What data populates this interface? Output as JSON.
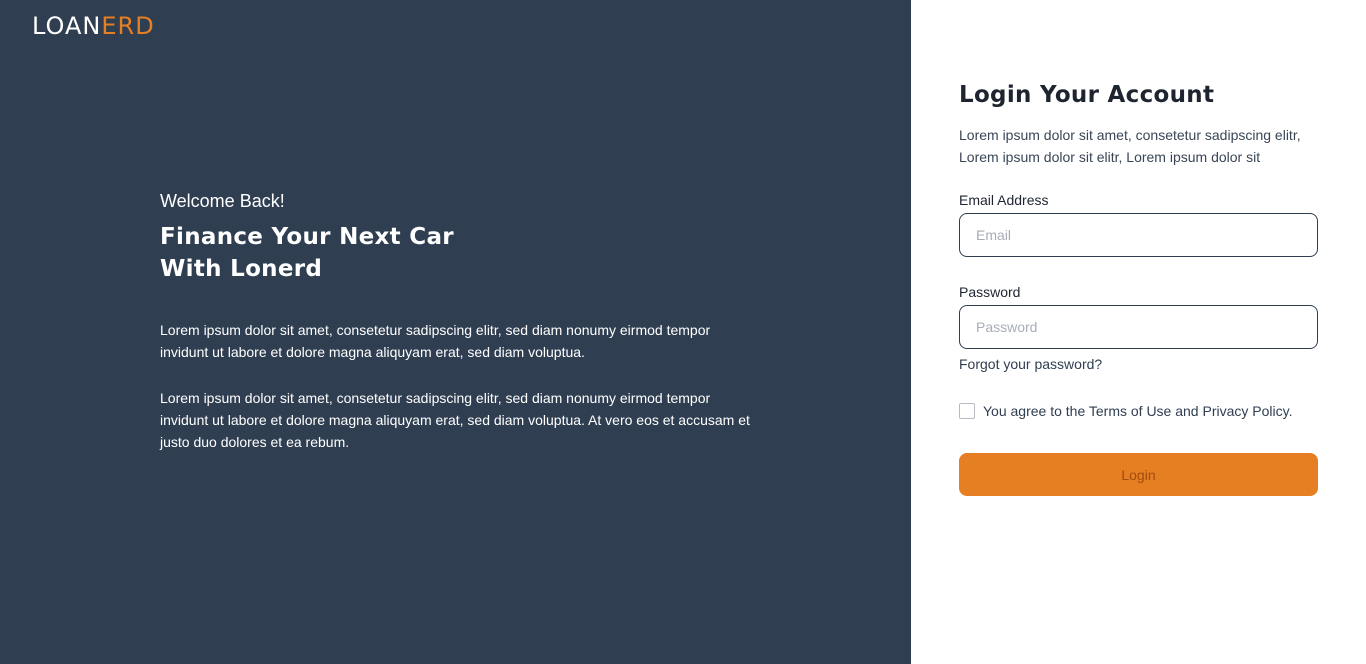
{
  "brand": {
    "logo_left": "LOAN",
    "logo_right": "ERD"
  },
  "hero": {
    "welcome": "Welcome Back!",
    "headline_line1": "Finance Your Next Car",
    "headline_line2": "With Lonerd",
    "paragraph1": "Lorem ipsum dolor sit amet, consetetur sadipscing elitr, sed diam nonumy eirmod tempor invidunt ut labore et dolore magna aliquyam erat, sed diam voluptua.",
    "paragraph2": "Lorem ipsum dolor sit amet, consetetur sadipscing elitr, sed diam nonumy eirmod tempor invidunt ut labore et dolore magna aliquyam erat, sed diam voluptua. At vero eos et accusam et justo duo dolores et ea rebum."
  },
  "login": {
    "title": "Login Your Account",
    "subtitle": "Lorem ipsum dolor sit amet, consetetur sadipscing elitr, Lorem ipsum dolor sit elitr, Lorem ipsum dolor sit",
    "email_label": "Email Address",
    "email_placeholder": "Email",
    "email_value": "",
    "password_label": "Password",
    "password_placeholder": "Password",
    "password_value": "",
    "forgot_link": "Forgot your password?",
    "agree_text": "You agree to the Terms of Use and Privacy Policy.",
    "agree_checked": false,
    "button_label": "Login"
  },
  "colors": {
    "panel": "#2f3e51",
    "accent": "#e67e22",
    "background": "#ffffff"
  }
}
